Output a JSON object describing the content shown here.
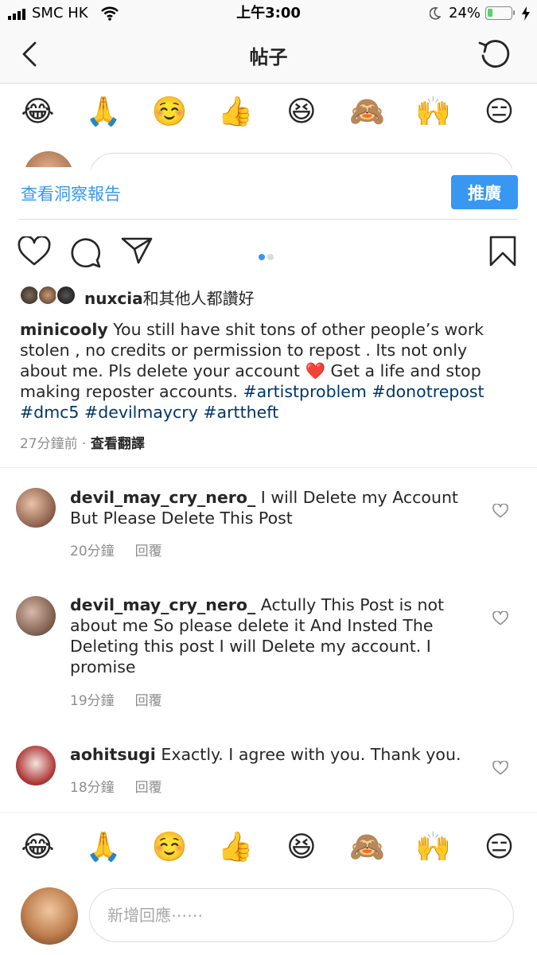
{
  "status_bar": {
    "carrier": "SMC HK",
    "time": "上午3:00",
    "battery_percent": "24%",
    "battery_level": 0.24
  },
  "nav": {
    "title": "帖子",
    "back_icon": "chevron-left-icon",
    "refresh_icon": "refresh-icon"
  },
  "emoji_bar_top": [
    "😂",
    "🙏",
    "☺️",
    "👍",
    "😆",
    "🙈",
    "🙌",
    "😑"
  ],
  "insights": {
    "link_label": "查看洞察報告",
    "promote_label": "推廣"
  },
  "actions": {
    "like_icon": "heart-outline-icon",
    "comment_icon": "comment-icon",
    "share_icon": "send-icon",
    "save_icon": "bookmark-icon",
    "carousel_index": 1,
    "carousel_count": 2
  },
  "likes": {
    "user": "nuxcia",
    "suffix": "和其他人都讚好"
  },
  "caption": {
    "username": "minicooly",
    "text_part1": "You still have shit tons of other people’s work stolen , no credits or permission to repost . Its not only about me. Pls delete your account ",
    "heart": "❤️",
    "text_part2": " Get a life and stop making reposter accounts. ",
    "hashtags": [
      "#artistproblem",
      "#donotrepost",
      "#dmc5",
      "#devilmaycry",
      "#arttheft"
    ],
    "time": "27分鐘前",
    "separator": " · ",
    "translate_label": "查看翻譯"
  },
  "comments": [
    {
      "username": "devil_may_cry_nero_",
      "text": "I will Delete my Account But Please Delete This Post",
      "time": "20分鐘",
      "reply_label": "回覆"
    },
    {
      "username": "devil_may_cry_nero_",
      "text": "Actully This Post is not about me So please delete it And Insted The Deleting this post I will Delete my account. I promise",
      "time": "19分鐘",
      "reply_label": "回覆"
    },
    {
      "username": "aohitsugi",
      "text": "Exactly. I agree with you. Thank you.",
      "time": "18分鐘",
      "reply_label": "回覆"
    }
  ],
  "emoji_bar_bottom": [
    "😂",
    "🙏",
    "☺️",
    "👍",
    "😆",
    "🙈",
    "🙌",
    "😑"
  ],
  "comment_input": {
    "placeholder": "新增回應⋯⋯"
  },
  "colors": {
    "accent_blue": "#3897f0",
    "hashtag": "#003569",
    "battery_green": "#4cd964",
    "heart_red": "#ed1c24"
  }
}
